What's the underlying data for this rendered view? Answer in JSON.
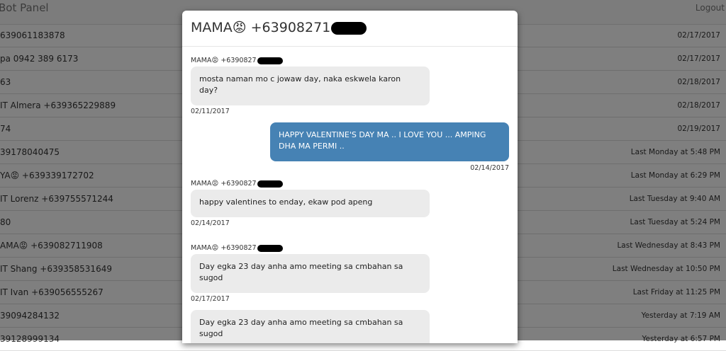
{
  "app": {
    "brand": "Bot Panel",
    "logout_label": "Logout"
  },
  "conversations": [
    {
      "name": "639061183878",
      "date": "02/17/2017"
    },
    {
      "name": "pa 0942 389 6173",
      "date": "02/17/2017"
    },
    {
      "name": "63",
      "date": "02/18/2017"
    },
    {
      "name": "IT Almera +639365229889",
      "date": "02/18/2017"
    },
    {
      "name": "74",
      "date": "02/19/2017"
    },
    {
      "name": "39178040475",
      "date": "Last Monday at 5:48 PM"
    },
    {
      "name": "YA😡 +639339172702",
      "date": "Last Monday at 6:29 PM"
    },
    {
      "name": "IT Lorenz +639755571244",
      "date": "Last Tuesday at 9:40 AM"
    },
    {
      "name": "80",
      "date": "Last Tuesday at 5:24 PM"
    },
    {
      "name": "AMA😡 +639082711908",
      "date": "Last Wednesday at 8:43 PM"
    },
    {
      "name": "IT Shang +639358531649",
      "date": "Last Wednesday at 10:50 PM"
    },
    {
      "name": "IT Ivan +639056555267",
      "date": "Last Friday at 11:25 PM"
    },
    {
      "name": "39094284132",
      "date": "Yesterday at 7:19 AM"
    },
    {
      "name": "39128999134",
      "date": "Yesterday at 6:57 PM"
    }
  ],
  "modal": {
    "title": "MAMA😡 +63908271",
    "messages": [
      {
        "sender": "MAMA😡 +6390827",
        "text": "mosta naman mo c jowaw day, naka eskwela karon day?",
        "date": "02/11/2017"
      },
      {
        "text": "HAPPY VALENTINE'S DAY MA .. I LOVE YOU ... AMPING DHA MA PERMI ..",
        "date": "02/14/2017"
      },
      {
        "sender": "MAMA😡 +6390827",
        "text": "happy valentines to enday, ekaw pod apeng",
        "date": "02/14/2017"
      },
      {
        "sender": "MAMA😡 +6390827",
        "text": "Day egka 23 day anha amo meeting sa cmbahan sa sugod",
        "date": "02/17/2017"
      },
      {
        "text": "Day egka 23 day anha amo meeting sa cmbahan sa sugod"
      }
    ]
  }
}
